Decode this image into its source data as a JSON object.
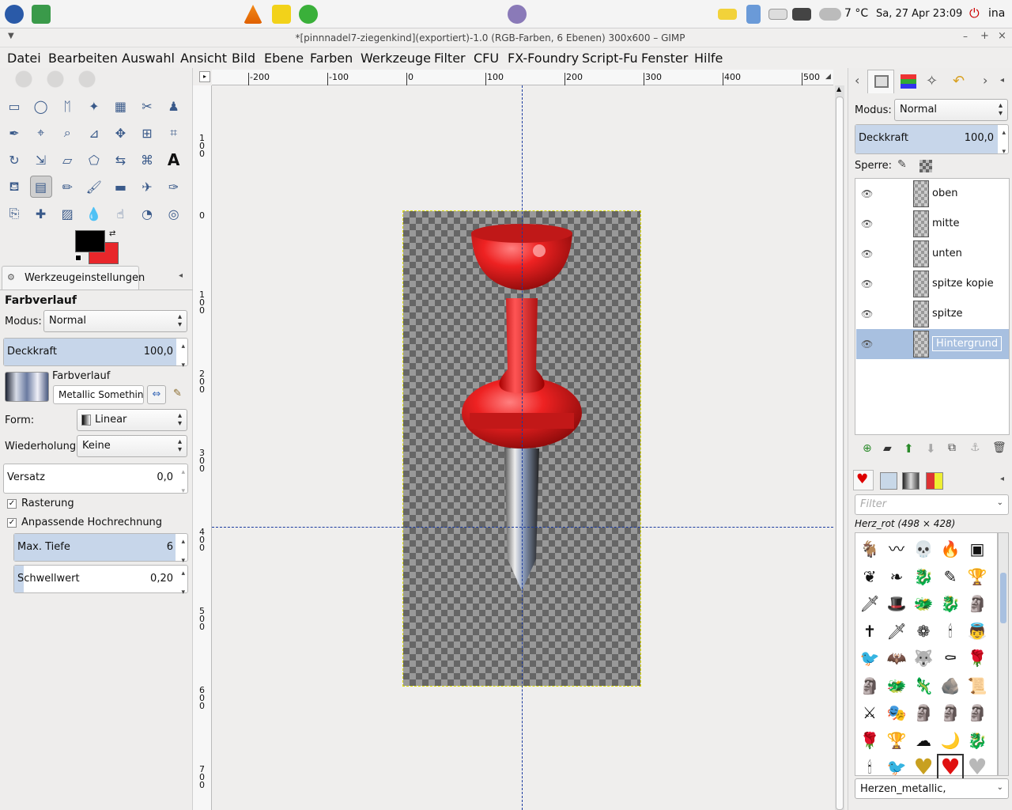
{
  "taskbar": {
    "weather": "7 °C",
    "datetime": "Sa, 27 Apr  23:09",
    "user": "ina"
  },
  "window": {
    "title": "*[pinnnadel7-ziegenkind](exportiert)-1.0 (RGB-Farben, 6 Ebenen) 300x600 – GIMP"
  },
  "menu": [
    "Datei",
    "Bearbeiten",
    "Auswahl",
    "Ansicht",
    "Bild",
    "Ebene",
    "Farben",
    "Werkzeuge",
    "Filter",
    "CFU",
    "FX-Foundry",
    "Script-Fu",
    "Fenster",
    "Hilfe"
  ],
  "toolopts": {
    "tab": "Werkzeugeinstellungen",
    "tool_title": "Farbverlauf",
    "modus_label": "Modus:",
    "modus_value": "Normal",
    "deckkraft_label": "Deckkraft",
    "deckkraft_value": "100,0",
    "farbverlauf_label": "Farbverlauf",
    "farbverlauf_value": "Metallic Something",
    "form_label": "Form:",
    "form_value": "Linear",
    "wiederholung_label": "Wiederholung:",
    "wiederholung_value": "Keine",
    "versatz_label": "Versatz",
    "versatz_value": "0,0",
    "rasterung_label": "Rasterung",
    "hochrechnung_label": "Anpassende Hochrechnung",
    "tiefe_label": "Max. Tiefe",
    "tiefe_value": "6",
    "schwellwert_label": "Schwellwert",
    "schwellwert_value": "0,20"
  },
  "ruler": {
    "h_ticks": [
      "-200",
      "-100",
      "0",
      "100",
      "200",
      "300",
      "400",
      "500"
    ],
    "v_ticks": [
      "1\n0\n0",
      "0",
      "1\n0\n0",
      "2\n0\n0",
      "3\n0\n0",
      "4\n0\n0",
      "5\n0\n0",
      "6\n0\n0",
      "7\n0\n0"
    ]
  },
  "layers": {
    "modus_label": "Modus:",
    "modus_value": "Normal",
    "deckkraft_label": "Deckkraft",
    "deckkraft_value": "100,0",
    "sperre_label": "Sperre:",
    "items": [
      {
        "name": "oben"
      },
      {
        "name": "mitte"
      },
      {
        "name": "unten"
      },
      {
        "name": "spitze kopie"
      },
      {
        "name": "spitze"
      },
      {
        "name": "Hintergrund"
      }
    ]
  },
  "brushes": {
    "filter_placeholder": "Filter",
    "selected": "Herz_rot (498 × 428)",
    "tag_value": "Herzen_metallic,"
  },
  "colors": {
    "fg": "#000000",
    "bg": "#e8272b",
    "selection": "#a8c0e0",
    "pin_red": "#e02424"
  }
}
